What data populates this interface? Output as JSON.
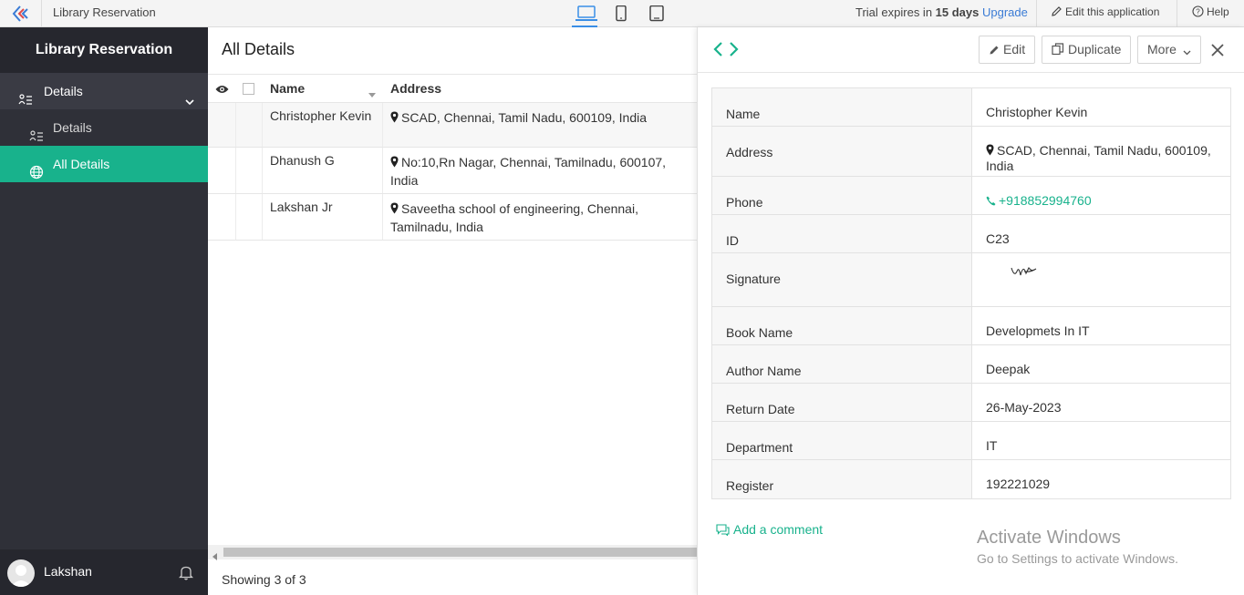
{
  "topbar": {
    "app_title": "Library Reservation",
    "trial_prefix": "Trial expires in",
    "trial_days": "15 days",
    "upgrade": "Upgrade",
    "edit_app": "Edit this application",
    "help": "Help",
    "accent": "#3a8ee6"
  },
  "sidebar": {
    "title": "Library Reservation",
    "items": [
      {
        "label": "Details",
        "type": "section"
      },
      {
        "label": "Details",
        "type": "report"
      },
      {
        "label": "All Details",
        "type": "report",
        "active": true
      }
    ],
    "user": "Lakshan",
    "active_color": "#18b28c"
  },
  "main": {
    "title": "All Details",
    "columns": [
      "Name",
      "Address"
    ],
    "rows": [
      {
        "name": "Christopher Kevin",
        "address": "SCAD, Chennai, Tamil Nadu, 600109, India"
      },
      {
        "name": "Dhanush G",
        "address": "No:10,Rn Nagar, Chennai, Tamilnadu, 600107, India"
      },
      {
        "name": "Lakshan Jr",
        "address": "Saveetha school of engineering, Chennai, Tamilnadu, India"
      }
    ],
    "footer": "Showing 3 of 3"
  },
  "detail": {
    "buttons": {
      "edit": "Edit",
      "duplicate": "Duplicate",
      "more": "More"
    },
    "fields": [
      {
        "label": "Name",
        "value": "Christopher Kevin"
      },
      {
        "label": "Address",
        "value": "SCAD, Chennai, Tamil Nadu, 600109, India"
      },
      {
        "label": "Phone",
        "value": "+918852994760"
      },
      {
        "label": "ID",
        "value": "C23"
      },
      {
        "label": "Signature",
        "value": ""
      },
      {
        "label": "Book Name",
        "value": "Developmets In IT"
      },
      {
        "label": "Author Name",
        "value": "Deepak"
      },
      {
        "label": "Return Date",
        "value": "26-May-2023"
      },
      {
        "label": "Department",
        "value": "IT"
      },
      {
        "label": "Register",
        "value": "192221029"
      }
    ],
    "add_comment": "Add a comment"
  },
  "watermark": {
    "line1": "Activate Windows",
    "line2": "Go to Settings to activate Windows."
  }
}
